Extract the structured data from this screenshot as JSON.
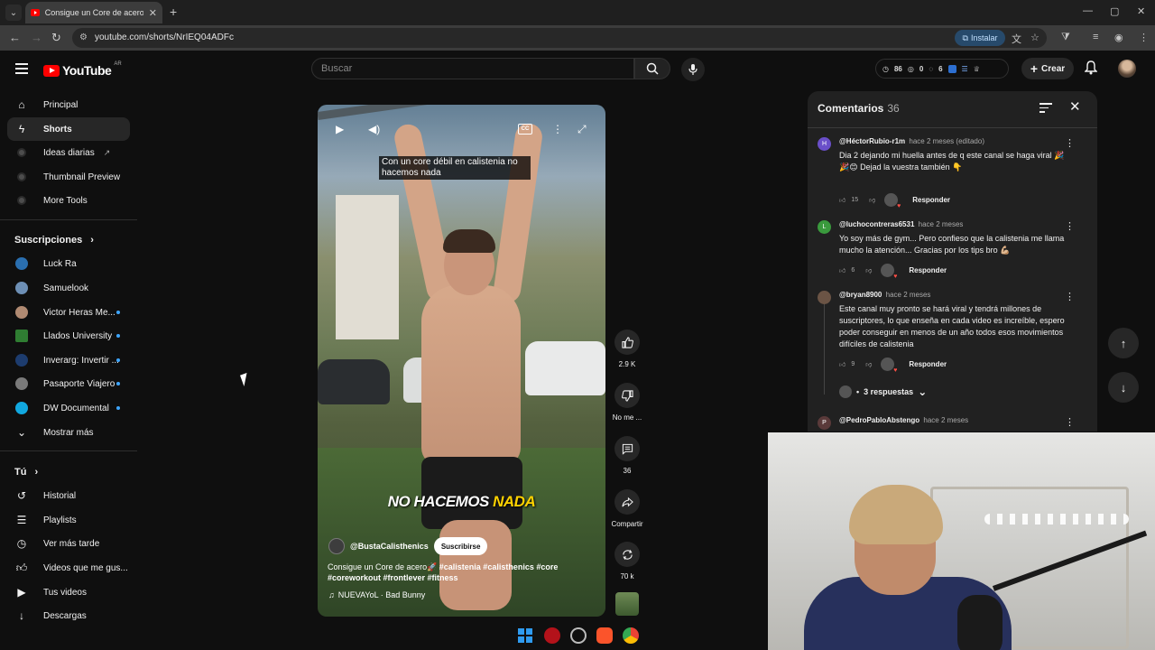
{
  "browser": {
    "tab_title": "Consigue un Core de acero🚀 S",
    "url": "youtube.com/shorts/NrIEQ04ADFc",
    "install_label": "Instalar"
  },
  "header": {
    "logo_text": "YouTube",
    "region": "AR",
    "search_placeholder": "Buscar",
    "stats": [
      "86",
      "0",
      "6"
    ],
    "create_label": "Crear"
  },
  "sidebar": {
    "main": [
      {
        "label": "Principal",
        "icon": "home-icon"
      },
      {
        "label": "Shorts",
        "icon": "shorts-icon"
      },
      {
        "label": "Ideas diarias",
        "icon": "extension-icon"
      },
      {
        "label": "Thumbnail Preview",
        "icon": "extension-icon"
      },
      {
        "label": "More Tools",
        "icon": "extension-icon"
      }
    ],
    "subs_heading": "Suscripciones",
    "subscriptions": [
      {
        "label": "Luck Ra",
        "color": "#2a6fb0",
        "dot": false
      },
      {
        "label": "Samuelook",
        "color": "#6d8fb5",
        "dot": false
      },
      {
        "label": "Victor Heras Me...",
        "color": "#b08a72",
        "dot": true
      },
      {
        "label": "Llados University",
        "color": "#2f7d32",
        "dot": true
      },
      {
        "label": "Inverarg: Invertir ...",
        "color": "#1d3c6e",
        "dot": true
      },
      {
        "label": "Pasaporte Viajero",
        "color": "#7a7a7a",
        "dot": true
      },
      {
        "label": "DW Documental",
        "color": "#11a8e0",
        "dot": true
      }
    ],
    "show_more": "Mostrar más",
    "you_heading": "Tú",
    "you": [
      {
        "label": "Historial",
        "icon": "history-icon"
      },
      {
        "label": "Playlists",
        "icon": "playlist-icon"
      },
      {
        "label": "Ver más tarde",
        "icon": "clock-icon"
      },
      {
        "label": "Videos que me gus...",
        "icon": "thumbs-up-icon"
      },
      {
        "label": "Tus videos",
        "icon": "video-icon"
      },
      {
        "label": "Descargas",
        "icon": "download-icon"
      }
    ]
  },
  "video": {
    "caption": "Con un core débil en calistenia no hacemos nada",
    "overlay_text_a": "NO HACEMOS ",
    "overlay_text_b": "NADA",
    "channel": "@BustaCalisthenics",
    "subscribe": "Suscribirse",
    "desc_text": "Consigue un Core de acero🚀 ",
    "desc_tags": "#calistenia #calisthenics #core #coreworkout #frontlever #fitness",
    "music": "NUEVAYoL · Bad Bunny"
  },
  "actions": {
    "likes": "2.9 K",
    "dislike": "No me ...",
    "comments": "36",
    "share": "Compartir",
    "remix": "70 k"
  },
  "comments": {
    "title": "Comentarios",
    "count": "36",
    "items": [
      {
        "initial": "H",
        "color": "#6a4fc9",
        "author": "@HéctorRubio-r1m",
        "time": "hace 2 meses (editado)",
        "text": "Dia 2 dejando mi huella antes de q este canal se haga viral 🎉🎉😊 Dejad la vuestra también 👇",
        "likes": "15",
        "reply": "Responder"
      },
      {
        "initial": "L",
        "color": "#3a9a3d",
        "author": "@luchocontreras6531",
        "time": "hace 2 meses",
        "text": "Yo soy más de gym... Pero confieso que la calistenia me llama mucho la atención... Gracias por los tips bro 💪🏼",
        "likes": "6",
        "reply": "Responder"
      },
      {
        "initial": "",
        "color": "#6b5445",
        "author": "@bryan8900",
        "time": "hace 2 meses",
        "text": "Este canal muy pronto se hará viral y tendrá millones de suscriptores, lo que enseña en cada video es increíble, espero poder conseguir en menos de un año todos esos movimientos difíciles de calistenia",
        "likes": "9",
        "reply": "Responder"
      },
      {
        "initial": "P",
        "color": "#5a3a3a",
        "author": "@PedroPabloAbstengo",
        "time": "hace 2 meses",
        "text": "",
        "likes": "",
        "reply": ""
      }
    ],
    "replies_label": "3 respuestas"
  }
}
